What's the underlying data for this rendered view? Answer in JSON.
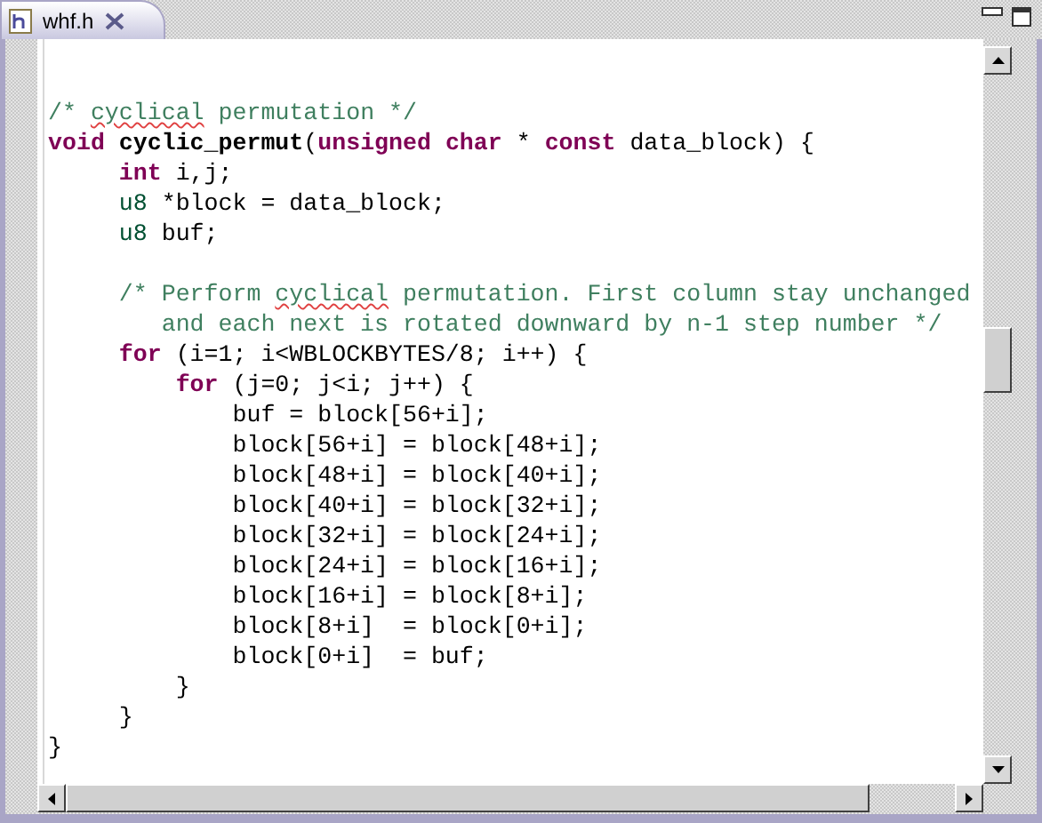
{
  "tabs": [
    {
      "label": "whf.h",
      "selected": true
    }
  ],
  "editor": {
    "lines": [
      {
        "kind": "code",
        "tokens": [
          {
            "kind": "comment",
            "text": "/* "
          },
          {
            "kind": "misspelled",
            "text": "cyclical"
          },
          {
            "kind": "comment",
            "text": " permutation */"
          }
        ]
      },
      {
        "kind": "code",
        "tokens": [
          {
            "kind": "keyword",
            "text": "void "
          },
          {
            "kind": "function",
            "text": "cyclic_permut"
          },
          {
            "kind": "plain",
            "text": "("
          },
          {
            "kind": "keyword",
            "text": "unsigned char"
          },
          {
            "kind": "plain",
            "text": " * "
          },
          {
            "kind": "keyword",
            "text": "const"
          },
          {
            "kind": "plain",
            "text": " data_block) {"
          }
        ]
      },
      {
        "kind": "code",
        "tokens": [
          {
            "kind": "keyword",
            "text": "     int"
          },
          {
            "kind": "plain",
            "text": " i,j;"
          }
        ]
      },
      {
        "kind": "code",
        "tokens": [
          {
            "kind": "type",
            "text": "     u8"
          },
          {
            "kind": "plain",
            "text": " *block = data_block;"
          }
        ]
      },
      {
        "kind": "code",
        "tokens": [
          {
            "kind": "type",
            "text": "     u8"
          },
          {
            "kind": "plain",
            "text": " buf;"
          }
        ]
      },
      {
        "kind": "blank"
      },
      {
        "kind": "code",
        "tokens": [
          {
            "kind": "comment",
            "text": "     /* Perform "
          },
          {
            "kind": "misspelled",
            "text": "cyclical"
          },
          {
            "kind": "comment",
            "text": " permutation. First column stay unchanged"
          }
        ]
      },
      {
        "kind": "code",
        "tokens": [
          {
            "kind": "comment",
            "text": "        and each next is rotated downward by n-1 step number */"
          }
        ]
      },
      {
        "kind": "code",
        "tokens": [
          {
            "kind": "keyword",
            "text": "     for"
          },
          {
            "kind": "plain",
            "text": " (i=1; i<WBLOCKBYTES/8; i++) {"
          }
        ]
      },
      {
        "kind": "code",
        "tokens": [
          {
            "kind": "keyword",
            "text": "         for"
          },
          {
            "kind": "plain",
            "text": " (j=0; j<i; j++) {"
          }
        ]
      },
      {
        "kind": "code",
        "tokens": [
          {
            "kind": "plain",
            "text": "             buf = block[56+i];"
          }
        ]
      },
      {
        "kind": "code",
        "tokens": [
          {
            "kind": "plain",
            "text": "             block[56+i] = block[48+i];"
          }
        ]
      },
      {
        "kind": "code",
        "tokens": [
          {
            "kind": "plain",
            "text": "             block[48+i] = block[40+i];"
          }
        ]
      },
      {
        "kind": "code",
        "tokens": [
          {
            "kind": "plain",
            "text": "             block[40+i] = block[32+i];"
          }
        ]
      },
      {
        "kind": "code",
        "tokens": [
          {
            "kind": "plain",
            "text": "             block[32+i] = block[24+i];"
          }
        ]
      },
      {
        "kind": "code",
        "tokens": [
          {
            "kind": "plain",
            "text": "             block[24+i] = block[16+i];"
          }
        ]
      },
      {
        "kind": "code",
        "tokens": [
          {
            "kind": "plain",
            "text": "             block[16+i] = block[8+i];"
          }
        ]
      },
      {
        "kind": "code",
        "tokens": [
          {
            "kind": "plain",
            "text": "             block[8+i]  = block[0+i];"
          }
        ]
      },
      {
        "kind": "code",
        "tokens": [
          {
            "kind": "plain",
            "text": "             block[0+i]  = buf;"
          }
        ]
      },
      {
        "kind": "code",
        "tokens": [
          {
            "kind": "plain",
            "text": "         }"
          }
        ]
      },
      {
        "kind": "code",
        "tokens": [
          {
            "kind": "plain",
            "text": "     }"
          }
        ]
      },
      {
        "kind": "code",
        "tokens": [
          {
            "kind": "plain",
            "text": "}"
          }
        ]
      }
    ]
  }
}
